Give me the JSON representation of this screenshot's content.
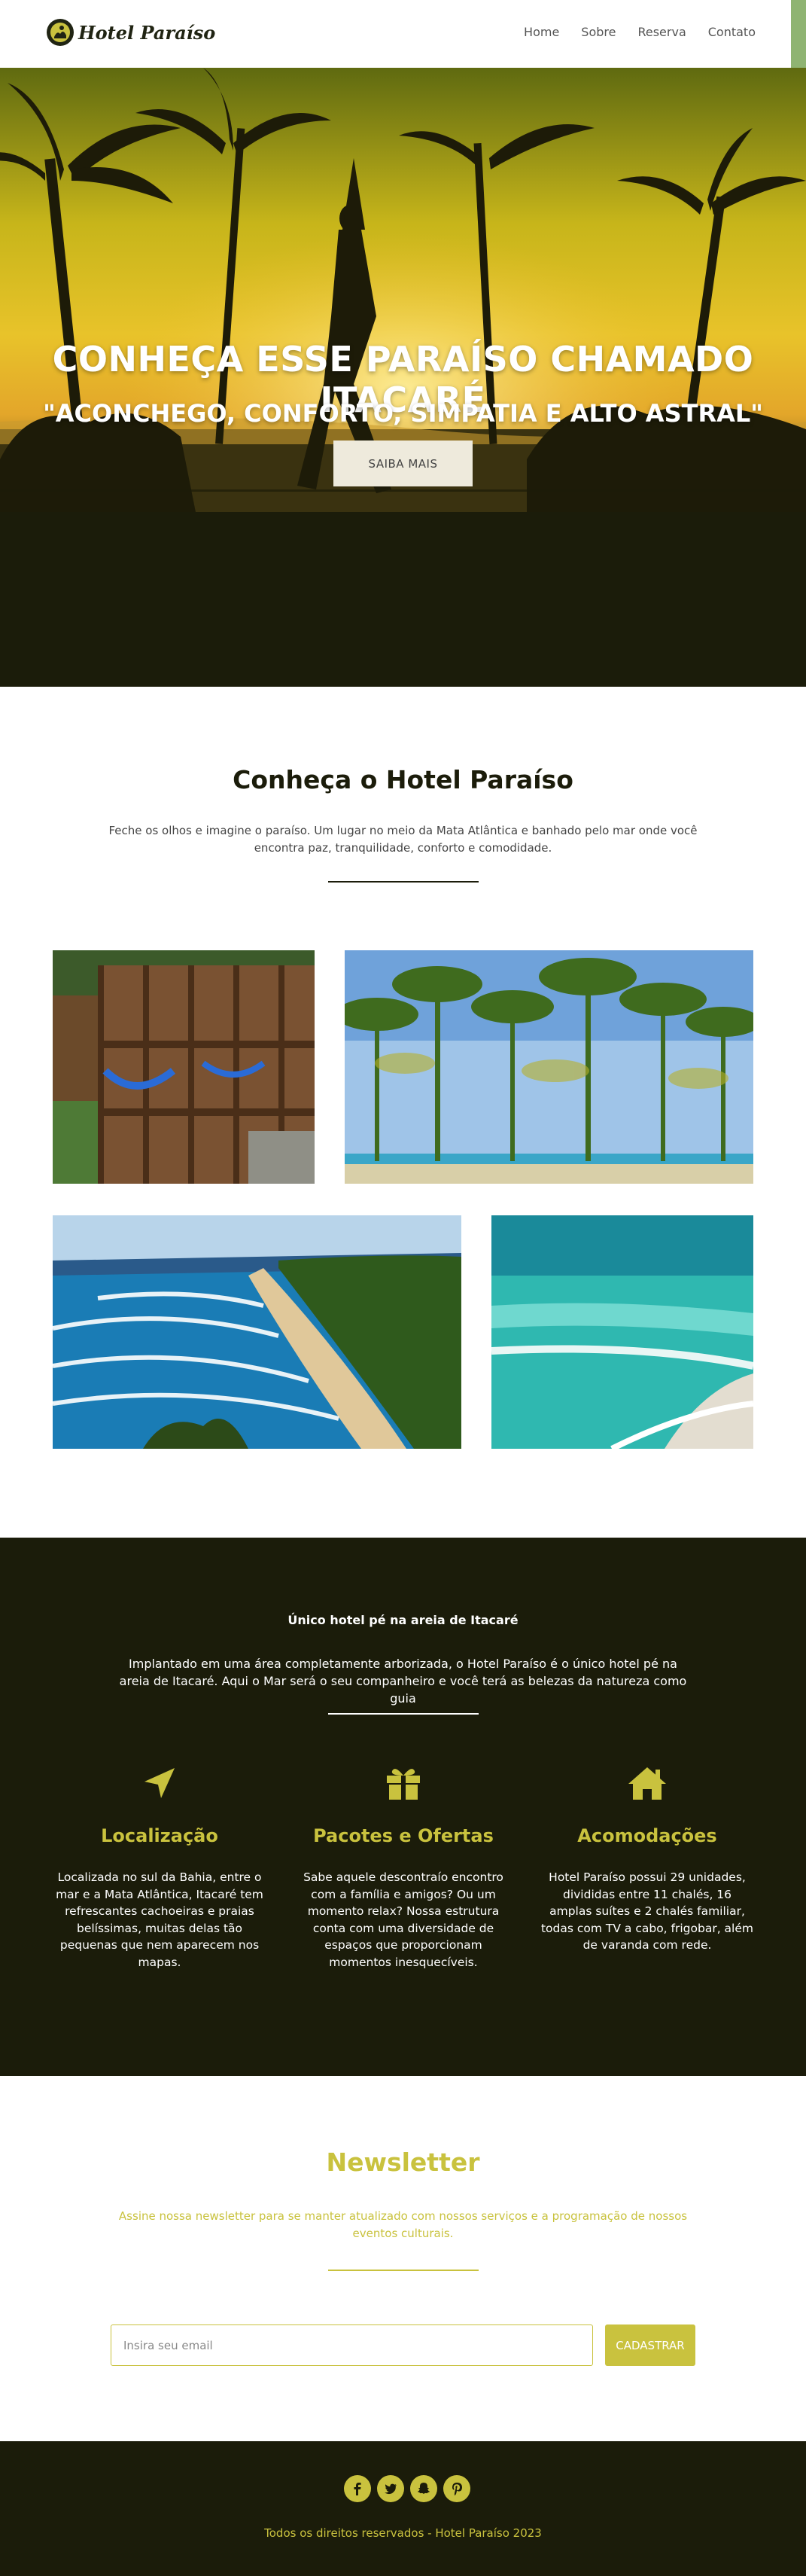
{
  "nav": {
    "logo_text": "Hotel Paraíso",
    "items": [
      "Home",
      "Sobre",
      "Reserva",
      "Contato"
    ]
  },
  "hero": {
    "title": "CONHEÇA ESSE PARAÍSO CHAMADO ITACARÉ",
    "subtitle": "\"ACONCHEGO, CONFORTO, SIMPATIA E ALTO ASTRAL\"",
    "button_label": "SAIBA MAIS"
  },
  "about": {
    "title": "Conheça o Hotel Paraíso",
    "description": "Feche os olhos e imagine o paraíso. Um lugar no meio da Mata Atlântica e banhado pelo mar onde você encontra paz, tranquilidade, conforto e comodidade.",
    "photos": [
      "wooden-chalet-photo",
      "palm-trees-beach-photo",
      "aerial-beach-photo",
      "turquoise-sea-photo"
    ]
  },
  "features": {
    "title": "Único hotel pé na areia de Itacaré",
    "description": "Implantado em uma área completamente arborizada, o Hotel Paraíso é o único hotel pé na areia de Itacaré. Aqui o Mar será o seu companheiro e você terá as belezas da natureza como guia",
    "columns": [
      {
        "icon": "location-arrow-icon",
        "title": "Localização",
        "text": "Localizada no sul da Bahia, entre o mar e a Mata Atlântica, Itacaré tem refrescantes cachoeiras e praias belíssimas, muitas delas tão pequenas que nem aparecem nos mapas."
      },
      {
        "icon": "gift-icon",
        "title": "Pacotes e Ofertas",
        "text": "Sabe aquele descontraío encontro com a família e amigos? Ou um momento relax? Nossa estrutura conta com uma diversidade de espaços que proporcionam momentos inesquecíveis."
      },
      {
        "icon": "home-icon",
        "title": "Acomodações",
        "text": "Hotel Paraíso possui 29 unidades, divididas entre 11 chalés, 16 amplas suítes e 2 chalés familiar, todas com TV a cabo, frigobar, além de varanda com rede."
      }
    ]
  },
  "newsletter": {
    "title": "Newsletter",
    "description": "Assine nossa newsletter para se manter atualizado com nossos serviços e a programação de nossos eventos culturais.",
    "email_placeholder": "Insira seu email",
    "button_label": "CADASTRAR"
  },
  "footer": {
    "socials": [
      "facebook-icon",
      "twitter-icon",
      "snapchat-icon",
      "pinterest-icon"
    ],
    "copyright": "Todos os direitos reservados - Hotel Paraíso 2023"
  },
  "colors": {
    "dark": "#1b1c0a",
    "accent": "#c9c23e",
    "nav_accent": "#8fb472",
    "button_bg": "#eeeadc"
  }
}
